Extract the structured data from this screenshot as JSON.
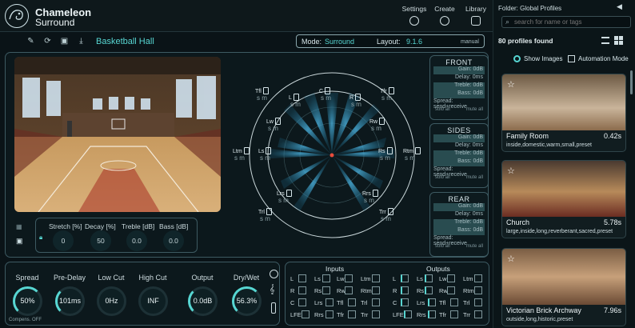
{
  "app": {
    "name_line1": "Chameleon",
    "name_line2": "Surround"
  },
  "header": {
    "settings": "Settings",
    "create": "Create",
    "library": "Library"
  },
  "toolbar": {
    "preset_name": "Basketball Hall"
  },
  "mode": {
    "mode_label": "Mode:",
    "mode_value": "Surround",
    "layout_label": "Layout:",
    "layout_value": "9.1.6",
    "manual": "manual"
  },
  "imagebox": {
    "stretch": "Stretch [%]",
    "decay": "Decay [%]",
    "treble": "Treble [dB]",
    "bass": "Bass [dB]",
    "stretch_val": "0",
    "decay_val": "50",
    "treble_val": "0.0",
    "bass_val": "0.0"
  },
  "radar_speakers": [
    "L",
    "C",
    "R",
    "Lw",
    "Rw",
    "Ltm",
    "Ls",
    "Rs",
    "Rtm",
    "Lrs",
    "Rrs",
    "Tfl",
    "Tfr",
    "Trl",
    "Trr"
  ],
  "sm": "s m",
  "zones": [
    {
      "title": "FRONT",
      "gain": "Gain: 0dB",
      "delay": "Delay: 0ms",
      "treble": "Treble: 0dB",
      "bass": "Bass: 0dB",
      "spread": "Spread: send+receive",
      "solo": "solo all",
      "mute": "mute all"
    },
    {
      "title": "SIDES",
      "gain": "Gain: 0dB",
      "delay": "Delay: 0ms",
      "treble": "Treble: 0dB",
      "bass": "Bass: 0dB",
      "spread": "Spread: send+receive",
      "solo": "solo all",
      "mute": "mute all"
    },
    {
      "title": "REAR",
      "gain": "Gain: 0dB",
      "delay": "Delay: 0ms",
      "treble": "Treble: 0dB",
      "bass": "Bass: 0dB",
      "spread": "Spread: send+receive",
      "solo": "solo all",
      "mute": "mute all"
    }
  ],
  "bottom": {
    "spread": "Spread",
    "predelay": "Pre-Delay",
    "lowcut": "Low Cut",
    "highcut": "High Cut",
    "output": "Output",
    "drywet": "Dry/Wet",
    "spread_val": "50%",
    "predelay_val": "101ms",
    "lowcut_val": "0Hz",
    "highcut_val": "INF",
    "output_val": "0.0dB",
    "drywet_val": "56.3%",
    "compens": "Compens. OFF"
  },
  "io": {
    "inputs": "Inputs",
    "outputs": "Outputs",
    "channels": [
      "L",
      "Ls",
      "Lw",
      "Ltm",
      "R",
      "Rs",
      "Rw",
      "Rtm",
      "C",
      "Lrs",
      "Tfl",
      "Trl",
      "LFE",
      "Rrs",
      "Tfr",
      "Trr"
    ]
  },
  "sidebar": {
    "folder": "Folder: Global Profiles",
    "search_placeholder": "search for name or tags",
    "count": "80 profiles found",
    "show_images": "Show Images",
    "automation": "Automation Mode",
    "cards": [
      {
        "name": "Family Room",
        "value": "0.42s",
        "tags": "inside,domestic,warm,small,preset"
      },
      {
        "name": "Church",
        "value": "5.78s",
        "tags": "large,inside,long,reverberant,sacred,preset"
      },
      {
        "name": "Victorian Brick Archway",
        "value": "7.96s",
        "tags": "outside,long,historic,preset"
      }
    ]
  }
}
